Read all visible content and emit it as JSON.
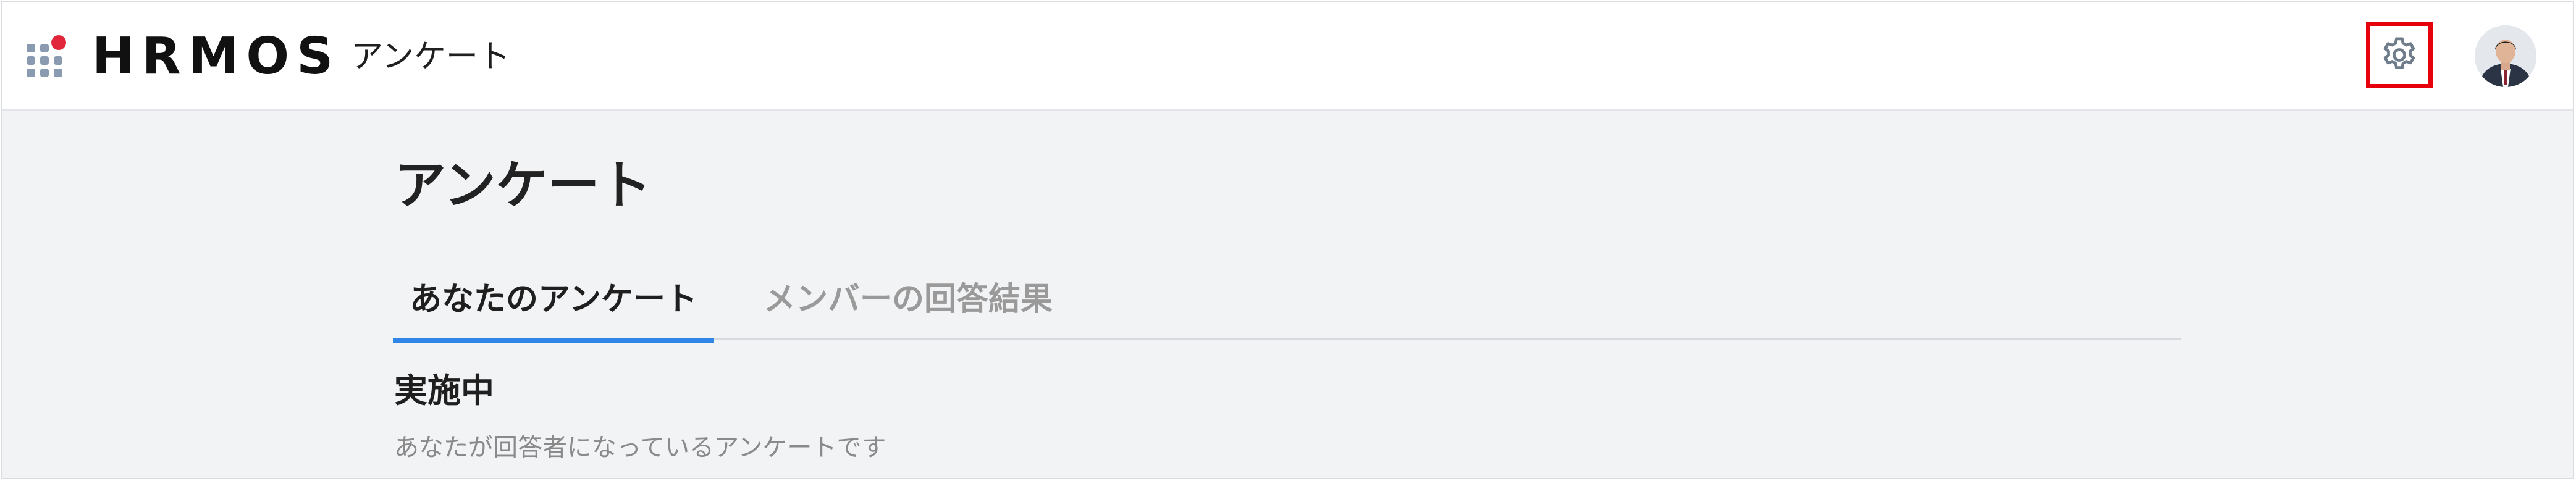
{
  "header": {
    "logo_text": "HRMOS",
    "app_title": "アンケート",
    "settings_icon": "gear-icon",
    "avatar_icon": "user-avatar",
    "grid_icon": "app-grid-icon",
    "accent_red": "#e1263c",
    "highlight_border": "#e5000c"
  },
  "main": {
    "page_title": "アンケート",
    "tabs": [
      {
        "label": "あなたのアンケート",
        "active": true
      },
      {
        "label": "メンバーの回答結果",
        "active": false
      }
    ],
    "tab_active_color": "#2f86e6",
    "section": {
      "title": "実施中",
      "description": "あなたが回答者になっているアンケートです"
    }
  }
}
